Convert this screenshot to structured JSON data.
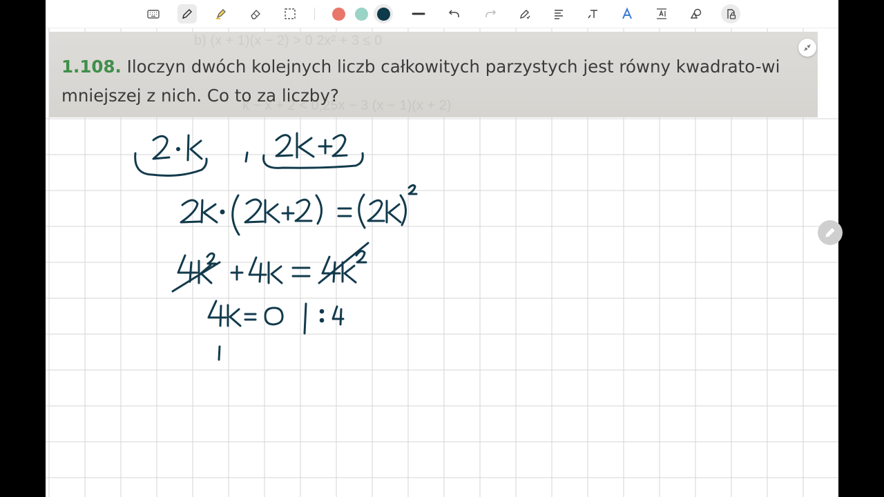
{
  "toolbar": {
    "tools": [
      "keyboard-icon",
      "pen-icon",
      "highlighter-icon",
      "eraser-icon",
      "lasso-select-icon"
    ],
    "colors": [
      "#e8776a",
      "#9bd3c6",
      "#0e3a4a"
    ],
    "actions": [
      "stroke-width-icon",
      "undo-icon",
      "redo-icon",
      "pen-settings-icon",
      "text-format-icon",
      "text-tool-icon",
      "ai-icon",
      "spacing-icon",
      "shapes-icon",
      "lock-icon"
    ]
  },
  "question": {
    "number": "1.108.",
    "text": "Iloczyn dwóch kolejnych liczb całkowitych parzystych jest równy kwadrato-wi mniejszej z nich. Co to za liczby?"
  },
  "ink_color": "#123a4c"
}
